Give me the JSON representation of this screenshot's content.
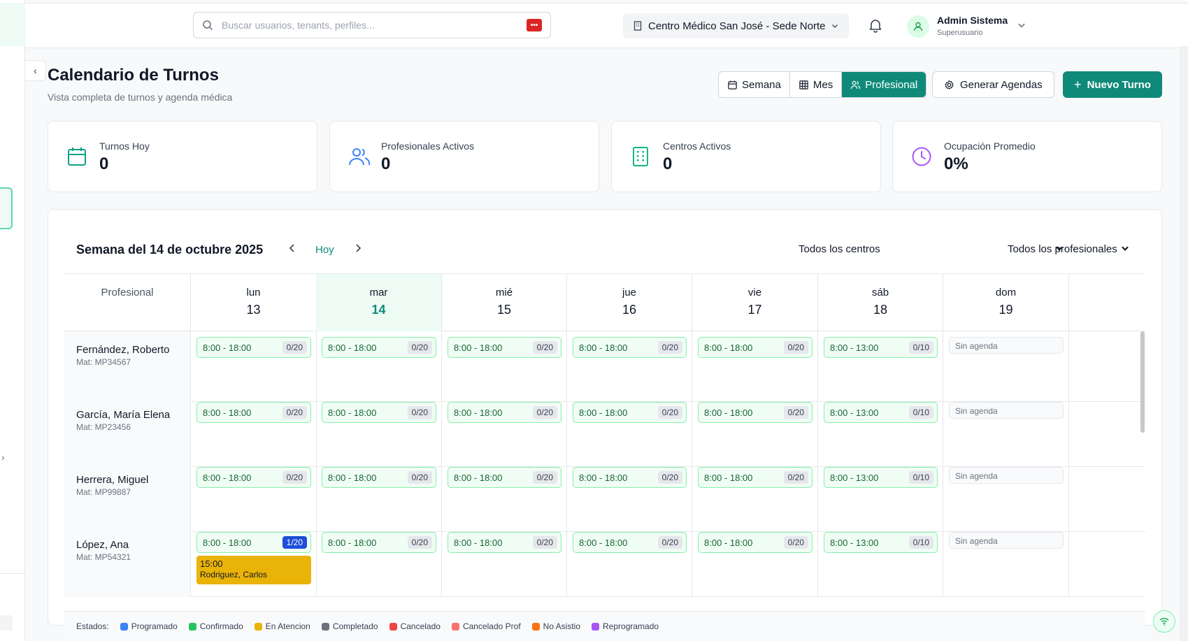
{
  "topbar": {
    "search_placeholder": "Buscar usuarios, tenants, perfiles...",
    "center": "Centro Médico San José - Sede Norte",
    "user_name": "Admin Sistema",
    "user_role": "Superusuario"
  },
  "page": {
    "title": "Calendario de Turnos",
    "subtitle": "Vista completa de turnos y agenda médica"
  },
  "views": {
    "week": "Semana",
    "month": "Mes",
    "professional": "Profesional"
  },
  "actions": {
    "generate": "Generar Agendas",
    "new_appt": "Nuevo Turno"
  },
  "stats": [
    {
      "label": "Turnos Hoy",
      "value": "0"
    },
    {
      "label": "Profesionales Activos",
      "value": "0"
    },
    {
      "label": "Centros Activos",
      "value": "0"
    },
    {
      "label": "Ocupación Promedio",
      "value": "0%"
    }
  ],
  "calendar": {
    "week_title": "Semana del 14 de octubre 2025",
    "today": "Hoy",
    "filter_centers": "Todos los centros",
    "filter_professionals": "Todos los profesionales",
    "prof_header": "Profesional",
    "days": [
      {
        "name": "lun",
        "num": "13"
      },
      {
        "name": "mar",
        "num": "14"
      },
      {
        "name": "mié",
        "num": "15"
      },
      {
        "name": "jue",
        "num": "16"
      },
      {
        "name": "vie",
        "num": "17"
      },
      {
        "name": "sáb",
        "num": "18"
      },
      {
        "name": "dom",
        "num": "19"
      }
    ],
    "professionals": [
      {
        "name": "Fernández, Roberto",
        "mat": "Mat: MP34567",
        "slots": [
          {
            "time": "8:00 - 18:00",
            "cap": "0/20"
          },
          {
            "time": "8:00 - 18:00",
            "cap": "0/20"
          },
          {
            "time": "8:00 - 18:00",
            "cap": "0/20"
          },
          {
            "time": "8:00 - 18:00",
            "cap": "0/20"
          },
          {
            "time": "8:00 - 18:00",
            "cap": "0/20"
          },
          {
            "time": "8:00 - 13:00",
            "cap": "0/10"
          },
          {
            "none": "Sin agenda"
          }
        ]
      },
      {
        "name": "García, María Elena",
        "mat": "Mat: MP23456",
        "slots": [
          {
            "time": "8:00 - 18:00",
            "cap": "0/20"
          },
          {
            "time": "8:00 - 18:00",
            "cap": "0/20"
          },
          {
            "time": "8:00 - 18:00",
            "cap": "0/20"
          },
          {
            "time": "8:00 - 18:00",
            "cap": "0/20"
          },
          {
            "time": "8:00 - 18:00",
            "cap": "0/20"
          },
          {
            "time": "8:00 - 13:00",
            "cap": "0/10"
          },
          {
            "none": "Sin agenda"
          }
        ]
      },
      {
        "name": "Herrera, Miguel",
        "mat": "Mat: MP99887",
        "slots": [
          {
            "time": "8:00 - 18:00",
            "cap": "0/20"
          },
          {
            "time": "8:00 - 18:00",
            "cap": "0/20"
          },
          {
            "time": "8:00 - 18:00",
            "cap": "0/20"
          },
          {
            "time": "8:00 - 18:00",
            "cap": "0/20"
          },
          {
            "time": "8:00 - 18:00",
            "cap": "0/20"
          },
          {
            "time": "8:00 - 13:00",
            "cap": "0/10"
          },
          {
            "none": "Sin agenda"
          }
        ]
      },
      {
        "name": "López, Ana",
        "mat": "Mat: MP54321",
        "slots": [
          {
            "time": "8:00 - 18:00",
            "cap": "1/20",
            "appt_time": "15:00",
            "appt_patient": "Rodriguez, Carlos"
          },
          {
            "time": "8:00 - 18:00",
            "cap": "0/20"
          },
          {
            "time": "8:00 - 18:00",
            "cap": "0/20"
          },
          {
            "time": "8:00 - 18:00",
            "cap": "0/20"
          },
          {
            "time": "8:00 - 18:00",
            "cap": "0/20"
          },
          {
            "time": "8:00 - 13:00",
            "cap": "0/10"
          },
          {
            "none": "Sin agenda"
          }
        ]
      }
    ]
  },
  "legend": {
    "title": "Estados:",
    "items": [
      {
        "label": "Programado",
        "color": "#3b82f6"
      },
      {
        "label": "Confirmado",
        "color": "#22c55e"
      },
      {
        "label": "En Atencion",
        "color": "#eab308"
      },
      {
        "label": "Completado",
        "color": "#6b7280"
      },
      {
        "label": "Cancelado",
        "color": "#ef4444"
      },
      {
        "label": "Cancelado Prof",
        "color": "#f87171"
      },
      {
        "label": "No Asistio",
        "color": "#f97316"
      },
      {
        "label": "Reprogramado",
        "color": "#a855f7"
      }
    ]
  },
  "colors": {
    "accent": "#0f8a7a",
    "today_bg": "#eefbf5"
  }
}
